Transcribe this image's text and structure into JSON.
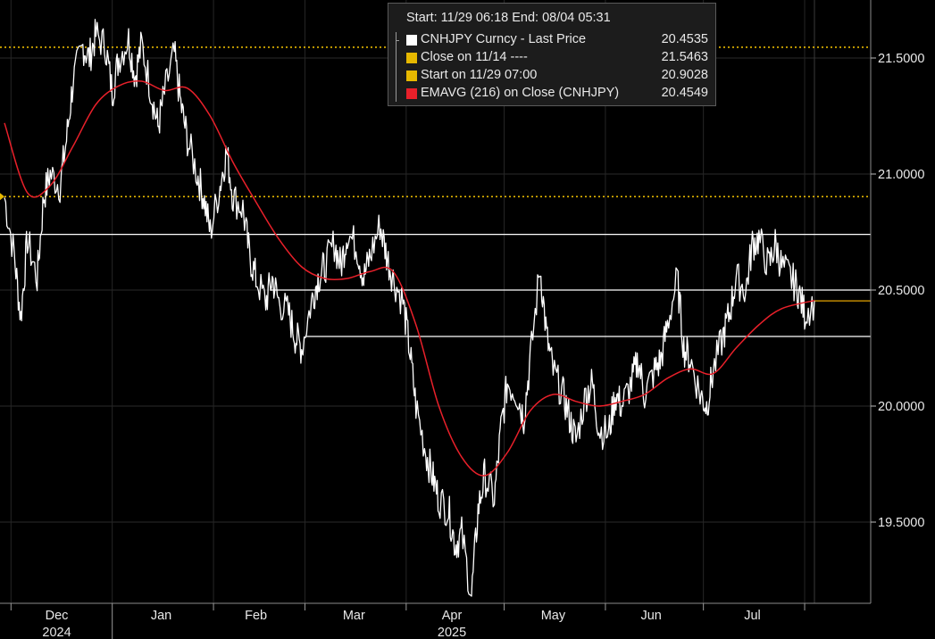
{
  "legend": {
    "header": "Start: 11/29 06:18 End: 08/04 05:31",
    "items": [
      {
        "label": "CNHJPY Curncy - Last Price",
        "value": "20.4535",
        "color": "#ffffff"
      },
      {
        "label": "Close on 11/14 ----",
        "value": "21.5463",
        "color": "#e6b800"
      },
      {
        "label": "Start on 11/29 07:00",
        "value": "20.9028",
        "color": "#e6b800"
      },
      {
        "label": "EMAVG (216)  on Close (CNHJPY)",
        "value": "20.4549",
        "color": "#e8202a"
      }
    ]
  },
  "chart_data": {
    "type": "line",
    "x_range": [
      "2024-11-29",
      "2025-08-04"
    ],
    "ylim": [
      19.15,
      21.75
    ],
    "y_ticks": [
      "21.5000",
      "21.0000",
      "20.5000",
      "20.0000",
      "19.5000"
    ],
    "y_tick_values": [
      21.5,
      21.0,
      20.5,
      20.0,
      19.5
    ],
    "x_tick_labels": [
      "Dec",
      "Jan",
      "Feb",
      "Mar",
      "Apr",
      "May",
      "Jun",
      "Jul"
    ],
    "x_year_labels": [
      "2024",
      "2025"
    ],
    "reference_lines": [
      {
        "name": "Close on 11/14",
        "value": 21.5463,
        "style": "dotted",
        "color": "#e6b800"
      },
      {
        "name": "Start on 11/29 07:00",
        "value": 20.9028,
        "style": "dotted",
        "color": "#e6b800"
      },
      {
        "value": 20.74,
        "style": "solid",
        "color": "#ffffff"
      },
      {
        "value": 20.5,
        "style": "solid",
        "color": "#ffffff"
      },
      {
        "value": 20.3,
        "style": "solid",
        "color": "#ffffff"
      }
    ],
    "series": [
      {
        "name": "CNHJPY Curncy - Last Price",
        "color": "#ffffff",
        "points": [
          [
            "2024-11-29",
            20.9
          ],
          [
            "2024-12-02",
            20.65
          ],
          [
            "2024-12-04",
            20.38
          ],
          [
            "2024-12-06",
            20.72
          ],
          [
            "2024-12-09",
            20.55
          ],
          [
            "2024-12-11",
            20.9
          ],
          [
            "2024-12-13",
            21.0
          ],
          [
            "2024-12-16",
            20.95
          ],
          [
            "2024-12-18",
            21.15
          ],
          [
            "2024-12-20",
            21.4
          ],
          [
            "2024-12-23",
            21.55
          ],
          [
            "2024-12-25",
            21.5
          ],
          [
            "2024-12-27",
            21.6
          ],
          [
            "2024-12-30",
            21.55
          ],
          [
            "2025-01-01",
            21.35
          ],
          [
            "2025-01-03",
            21.5
          ],
          [
            "2025-01-06",
            21.58
          ],
          [
            "2025-01-08",
            21.42
          ],
          [
            "2025-01-10",
            21.56
          ],
          [
            "2025-01-13",
            21.35
          ],
          [
            "2025-01-15",
            21.2
          ],
          [
            "2025-01-17",
            21.35
          ],
          [
            "2025-01-20",
            21.52
          ],
          [
            "2025-01-22",
            21.3
          ],
          [
            "2025-01-24",
            21.15
          ],
          [
            "2025-01-27",
            21.0
          ],
          [
            "2025-01-29",
            20.9
          ],
          [
            "2025-01-31",
            20.75
          ],
          [
            "2025-02-03",
            20.95
          ],
          [
            "2025-02-05",
            21.1
          ],
          [
            "2025-02-07",
            20.9
          ],
          [
            "2025-02-10",
            20.85
          ],
          [
            "2025-02-12",
            20.65
          ],
          [
            "2025-02-14",
            20.55
          ],
          [
            "2025-02-17",
            20.45
          ],
          [
            "2025-02-19",
            20.55
          ],
          [
            "2025-02-21",
            20.45
          ],
          [
            "2025-02-24",
            20.4
          ],
          [
            "2025-02-26",
            20.3
          ],
          [
            "2025-02-28",
            20.25
          ],
          [
            "2025-03-03",
            20.45
          ],
          [
            "2025-03-05",
            20.55
          ],
          [
            "2025-03-07",
            20.6
          ],
          [
            "2025-03-10",
            20.7
          ],
          [
            "2025-03-12",
            20.6
          ],
          [
            "2025-03-14",
            20.75
          ],
          [
            "2025-03-17",
            20.68
          ],
          [
            "2025-03-19",
            20.55
          ],
          [
            "2025-03-21",
            20.65
          ],
          [
            "2025-03-24",
            20.78
          ],
          [
            "2025-03-26",
            20.65
          ],
          [
            "2025-03-28",
            20.55
          ],
          [
            "2025-03-31",
            20.45
          ],
          [
            "2025-04-02",
            20.25
          ],
          [
            "2025-04-04",
            20.0
          ],
          [
            "2025-04-07",
            19.8
          ],
          [
            "2025-04-09",
            19.7
          ],
          [
            "2025-04-11",
            19.6
          ],
          [
            "2025-04-14",
            19.55
          ],
          [
            "2025-04-16",
            19.4
          ],
          [
            "2025-04-18",
            19.45
          ],
          [
            "2025-04-21",
            19.18
          ],
          [
            "2025-04-23",
            19.55
          ],
          [
            "2025-04-25",
            19.7
          ],
          [
            "2025-04-28",
            19.6
          ],
          [
            "2025-04-30",
            19.9
          ],
          [
            "2025-05-02",
            20.1
          ],
          [
            "2025-05-05",
            20.05
          ],
          [
            "2025-05-07",
            19.95
          ],
          [
            "2025-05-09",
            20.2
          ],
          [
            "2025-05-12",
            20.6
          ],
          [
            "2025-05-14",
            20.3
          ],
          [
            "2025-05-16",
            20.15
          ],
          [
            "2025-05-19",
            20.05
          ],
          [
            "2025-05-21",
            19.95
          ],
          [
            "2025-05-23",
            19.85
          ],
          [
            "2025-05-26",
            20.05
          ],
          [
            "2025-05-28",
            20.1
          ],
          [
            "2025-05-30",
            19.9
          ],
          [
            "2025-06-02",
            19.88
          ],
          [
            "2025-06-04",
            20.05
          ],
          [
            "2025-06-06",
            20.0
          ],
          [
            "2025-06-09",
            20.1
          ],
          [
            "2025-06-11",
            20.2
          ],
          [
            "2025-06-13",
            20.05
          ],
          [
            "2025-06-16",
            20.15
          ],
          [
            "2025-06-18",
            20.2
          ],
          [
            "2025-06-20",
            20.35
          ],
          [
            "2025-06-23",
            20.55
          ],
          [
            "2025-06-25",
            20.25
          ],
          [
            "2025-06-27",
            20.2
          ],
          [
            "2025-06-30",
            20.05
          ],
          [
            "2025-07-02",
            20.0
          ],
          [
            "2025-07-04",
            20.15
          ],
          [
            "2025-07-07",
            20.3
          ],
          [
            "2025-07-09",
            20.4
          ],
          [
            "2025-07-11",
            20.55
          ],
          [
            "2025-07-14",
            20.5
          ],
          [
            "2025-07-16",
            20.7
          ],
          [
            "2025-07-18",
            20.72
          ],
          [
            "2025-07-21",
            20.6
          ],
          [
            "2025-07-23",
            20.7
          ],
          [
            "2025-07-25",
            20.6
          ],
          [
            "2025-07-28",
            20.55
          ],
          [
            "2025-07-30",
            20.5
          ],
          [
            "2025-08-01",
            20.4
          ],
          [
            "2025-08-04",
            20.4535
          ]
        ]
      },
      {
        "name": "EMAVG (216)  on Close (CNHJPY)",
        "color": "#e8202a",
        "points": [
          [
            "2024-11-29",
            21.22
          ],
          [
            "2024-12-06",
            20.92
          ],
          [
            "2024-12-13",
            20.95
          ],
          [
            "2024-12-20",
            21.12
          ],
          [
            "2024-12-27",
            21.3
          ],
          [
            "2025-01-03",
            21.38
          ],
          [
            "2025-01-10",
            21.4
          ],
          [
            "2025-01-17",
            21.36
          ],
          [
            "2025-01-24",
            21.37
          ],
          [
            "2025-01-31",
            21.25
          ],
          [
            "2025-02-07",
            21.05
          ],
          [
            "2025-02-14",
            20.88
          ],
          [
            "2025-02-21",
            20.72
          ],
          [
            "2025-02-28",
            20.6
          ],
          [
            "2025-03-07",
            20.55
          ],
          [
            "2025-03-14",
            20.55
          ],
          [
            "2025-03-21",
            20.58
          ],
          [
            "2025-03-28",
            20.58
          ],
          [
            "2025-04-04",
            20.35
          ],
          [
            "2025-04-11",
            20.0
          ],
          [
            "2025-04-18",
            19.78
          ],
          [
            "2025-04-25",
            19.7
          ],
          [
            "2025-05-02",
            19.8
          ],
          [
            "2025-05-09",
            19.98
          ],
          [
            "2025-05-16",
            20.05
          ],
          [
            "2025-05-23",
            20.02
          ],
          [
            "2025-05-30",
            20.0
          ],
          [
            "2025-06-06",
            20.02
          ],
          [
            "2025-06-13",
            20.05
          ],
          [
            "2025-06-20",
            20.12
          ],
          [
            "2025-06-27",
            20.16
          ],
          [
            "2025-07-04",
            20.14
          ],
          [
            "2025-07-11",
            20.25
          ],
          [
            "2025-07-18",
            20.35
          ],
          [
            "2025-07-25",
            20.42
          ],
          [
            "2025-08-04",
            20.4549
          ]
        ]
      }
    ]
  }
}
